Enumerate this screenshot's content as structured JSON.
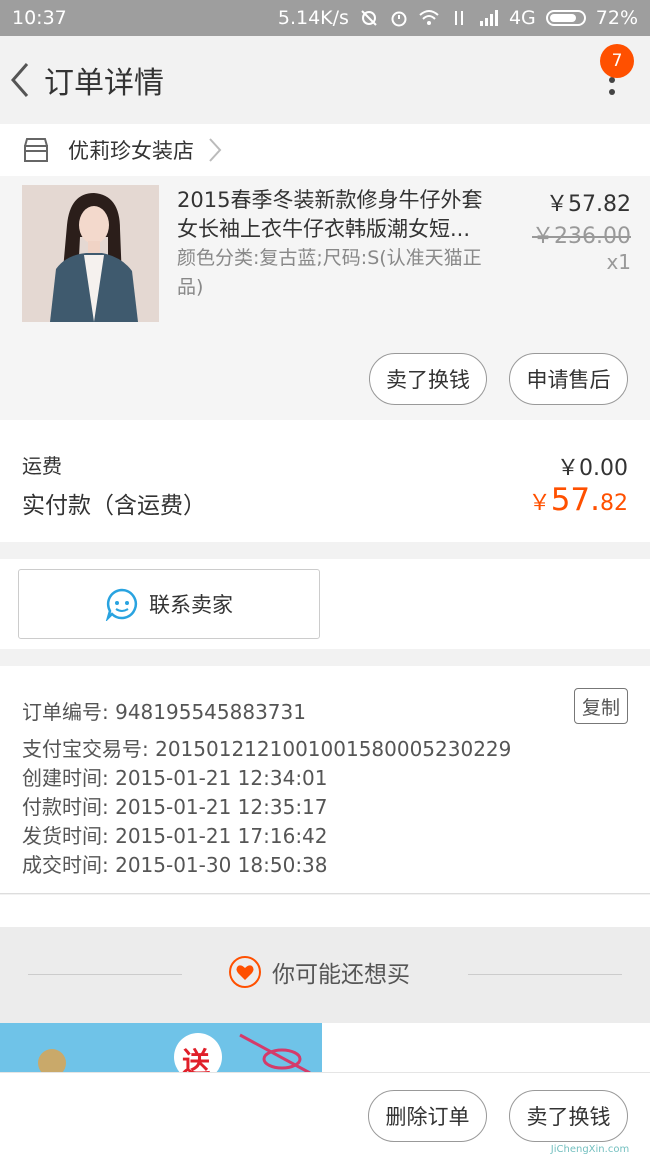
{
  "status_bar": {
    "time": "10:37",
    "speed": "5.14K/s",
    "network": "4G",
    "battery": "72%"
  },
  "nav": {
    "title": "订单详情",
    "badge_count": "7"
  },
  "store": {
    "name": "优莉珍女装店"
  },
  "item": {
    "title": "2015春季冬装新款修身牛仔外套女长袖上衣牛仔衣韩版潮女短...",
    "spec": "颜色分类:复古蓝;尺码:S(认准天猫正品)",
    "price": "￥57.82",
    "original_price": "￥236.00",
    "quantity": "x1"
  },
  "item_actions": {
    "sell": "卖了换钱",
    "after_sale": "申请售后"
  },
  "fees": {
    "shipping_label": "运费",
    "shipping_value": "￥0.00",
    "paid_label": "实付款（含运费）",
    "paid_symbol": "￥",
    "paid_int": "57.",
    "paid_dec": "82"
  },
  "contact": {
    "label": "联系卖家"
  },
  "order_info": {
    "copy_label": "复制",
    "rows": [
      "订单编号: 948195545883731",
      "支付宝交易号: 2015012121001001580005230229",
      "创建时间: 2015-01-21 12:34:01",
      "付款时间: 2015-01-21 12:35:17",
      "发货时间: 2015-01-21 17:16:42",
      "成交时间: 2015-01-30 18:50:38"
    ]
  },
  "recommend": {
    "label": "你可能还想买",
    "promo_text": "送"
  },
  "bottom_actions": {
    "delete": "删除订单",
    "sell": "卖了换钱"
  },
  "watermark": "JiChengXin.com",
  "colors": {
    "accent": "#ff5000",
    "badge": "#ff5000",
    "contact_icon": "#29a3e0"
  }
}
